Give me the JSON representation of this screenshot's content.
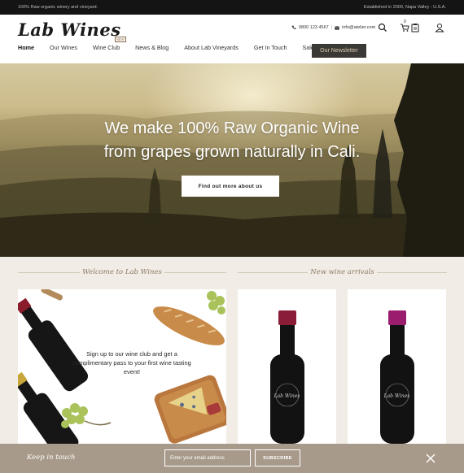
{
  "topbar": {
    "left": "100% Raw organic winery and vineyard.",
    "right": "Established in 2000, Napa Valley - U.S.A."
  },
  "header": {
    "logo": "Lab Wines",
    "phone": "0800 123 4567",
    "email": "info@atelier.com",
    "cart_count": "0",
    "icons": [
      "phone-icon",
      "mail-icon",
      "search-icon",
      "cart-icon",
      "clipboard-icon",
      "user-icon"
    ]
  },
  "nav": {
    "items": [
      "Home",
      "Our Wines",
      "Wine Club",
      "News & Blog",
      "About Lab Vineyards",
      "Get In Touch",
      "Sale & Offers"
    ],
    "badge": "NEW",
    "newsletter": "Our Newsletter"
  },
  "hero": {
    "line1": "We make 100% Raw Organic Wine",
    "line2": "from grapes grown naturally in Cali.",
    "button": "Find out more about us"
  },
  "sections": {
    "welcome_title": "Welcome to Lab Wines",
    "arrivals_title": "New wine arrivals",
    "promo_text": "Sign up to our wine club and get a complimentary pass to your first wine tasting event!",
    "bottle_label": "Lab Wines"
  },
  "footer": {
    "title": "Keep in touch",
    "email_placeholder": "Enter your email address",
    "subscribe": "SUBSCRIBE"
  },
  "colors": {
    "accent": "#8d7b63",
    "footer_bg": "#a89a8a",
    "dark": "#141414"
  }
}
